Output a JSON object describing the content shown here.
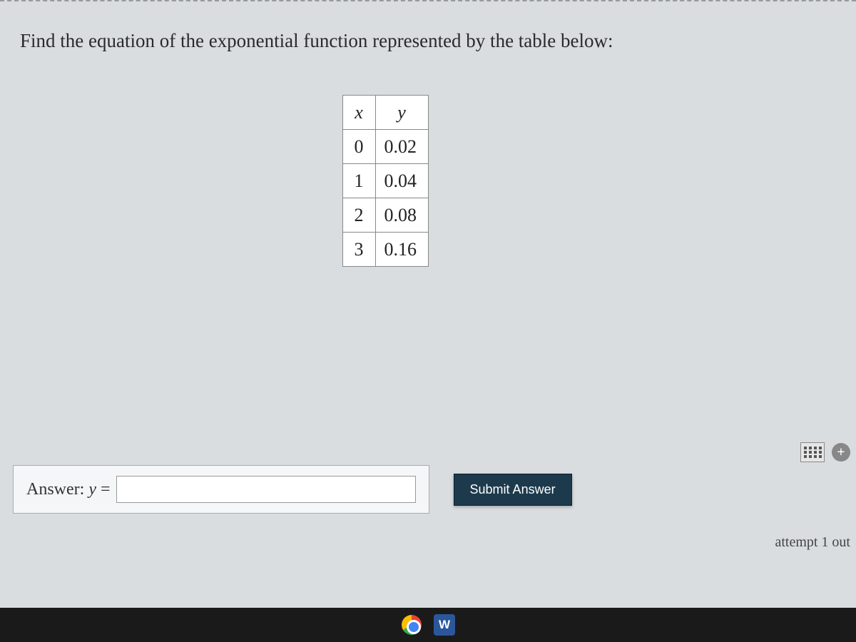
{
  "question": "Find the equation of the exponential function represented by the table below:",
  "table": {
    "headers": {
      "x": "x",
      "y": "y"
    },
    "rows": [
      {
        "x": "0",
        "y": "0.02"
      },
      {
        "x": "1",
        "y": "0.04"
      },
      {
        "x": "2",
        "y": "0.08"
      },
      {
        "x": "3",
        "y": "0.16"
      }
    ]
  },
  "answer": {
    "label_prefix": "Answer: ",
    "label_var": "y",
    "label_equals": " =",
    "value": ""
  },
  "submit_label": "Submit Answer",
  "attempt_text": "attempt 1 out",
  "plus_glyph": "+",
  "word_glyph": "W"
}
